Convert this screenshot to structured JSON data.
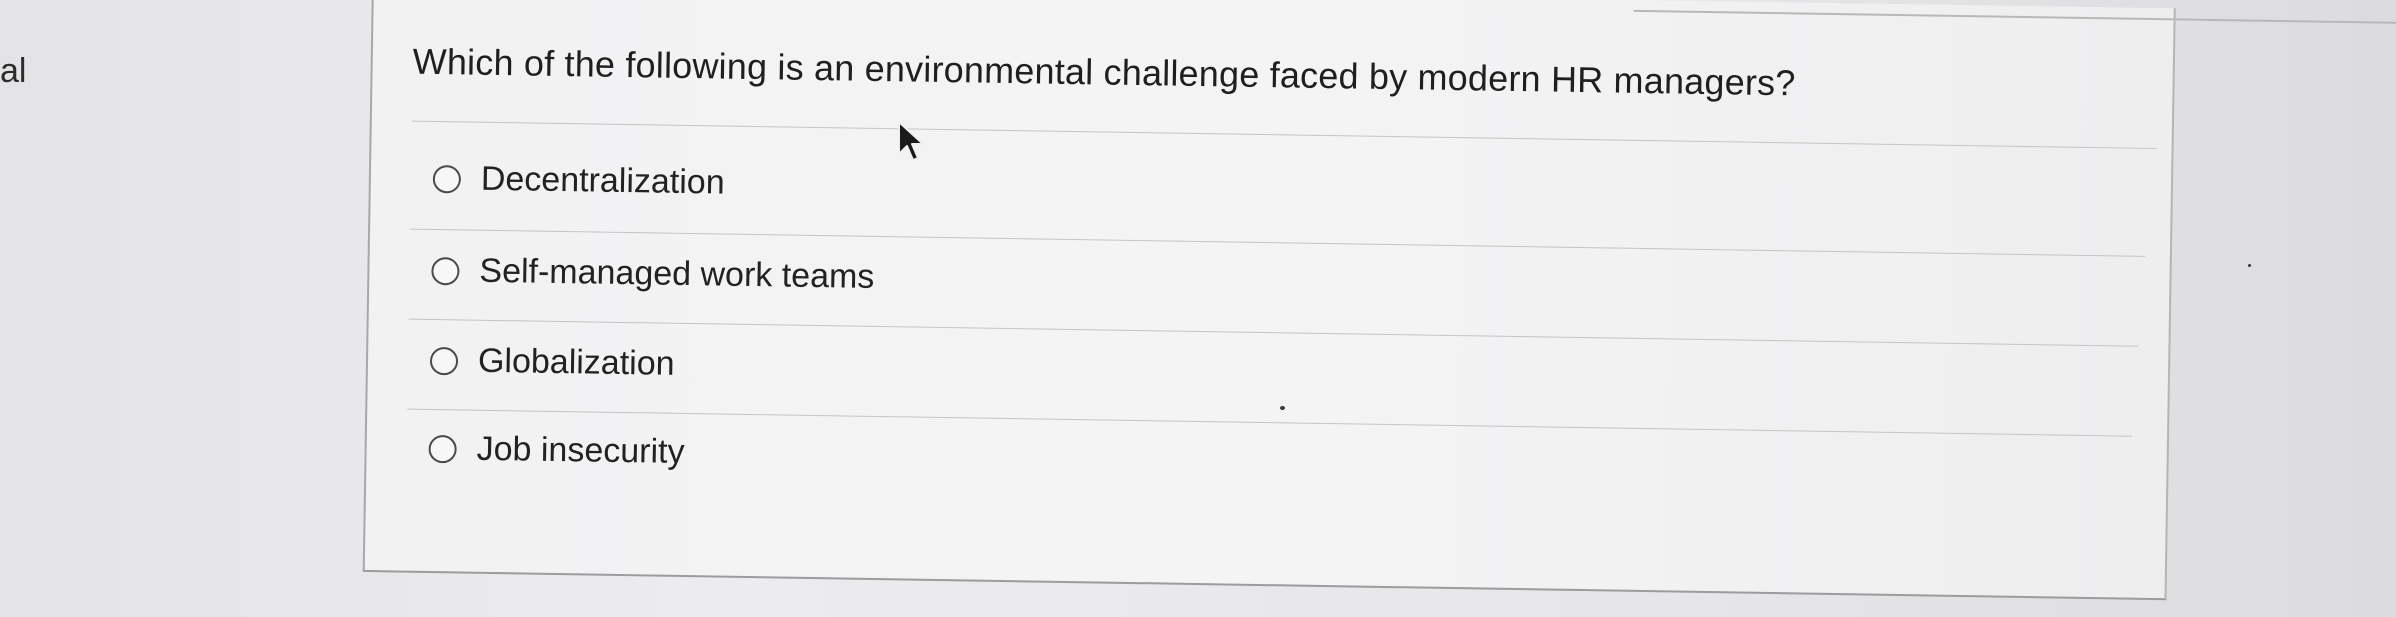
{
  "left_fragment": "al",
  "question": {
    "text": "Which of the following is an environmental challenge faced by modern HR managers?"
  },
  "options": [
    {
      "label": "Decentralization",
      "selected": false
    },
    {
      "label": "Self-managed work teams",
      "selected": false
    },
    {
      "label": "Globalization",
      "selected": false
    },
    {
      "label": "Job insecurity",
      "selected": false
    }
  ]
}
